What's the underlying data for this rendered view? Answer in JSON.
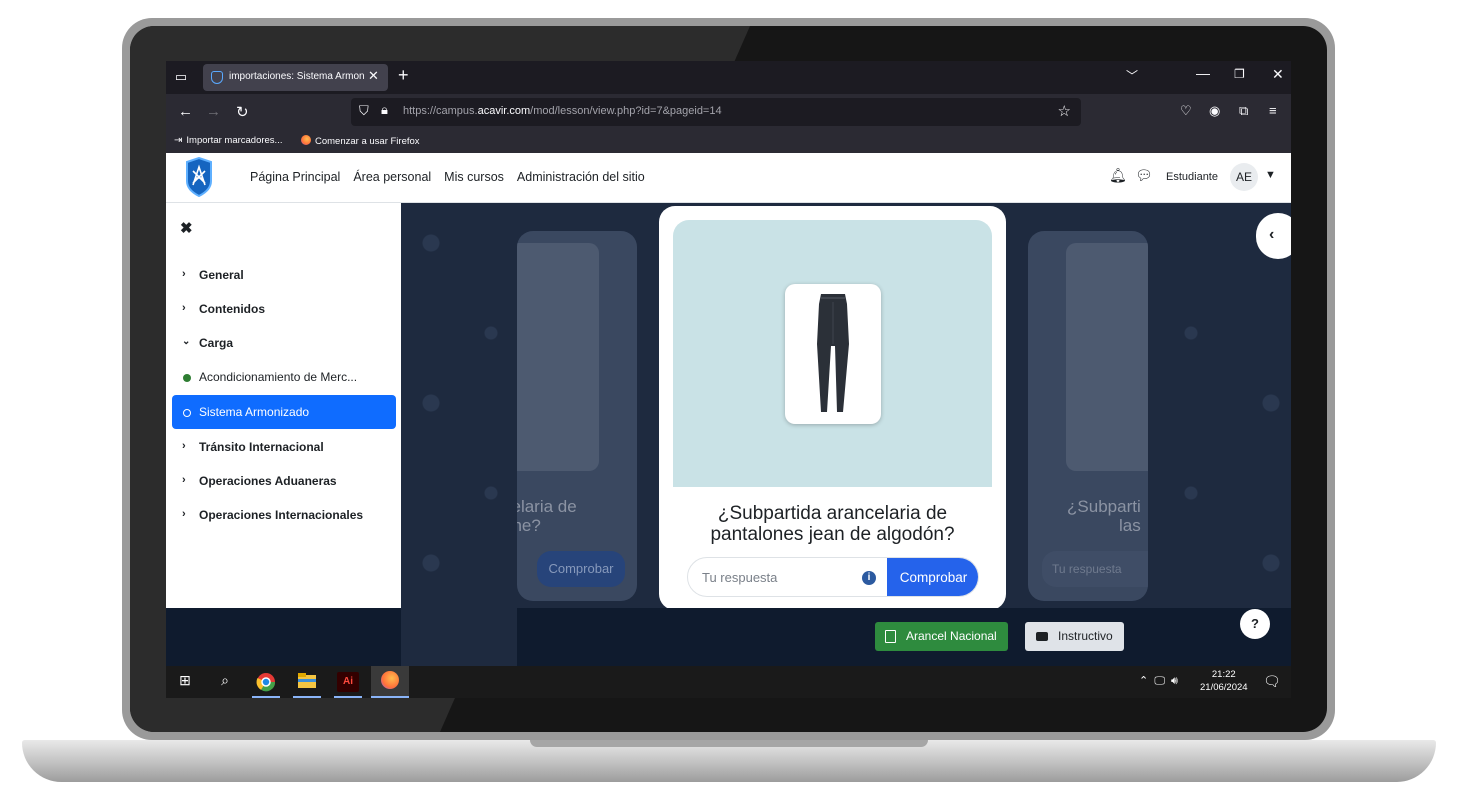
{
  "browser": {
    "tab_title": "importaciones: Sistema Armonizado",
    "tab_close": "✕",
    "new_tab": "+",
    "url_prefix": "https://campus.",
    "url_host": "acavir.com",
    "url_suffix": "/mod/lesson/view.php?id=7&pageid=14",
    "bookmarks": [
      "Importar marcadores...",
      "Comenzar a usar Firefox"
    ]
  },
  "header": {
    "nav": [
      "Página Principal",
      "Área personal",
      "Mis cursos",
      "Administración del sitio"
    ],
    "role": "Estudiante",
    "avatar": "AE"
  },
  "course_index": {
    "close": "✖",
    "items": [
      {
        "label": "General",
        "type": "section",
        "state": "collapsed"
      },
      {
        "label": "Contenidos",
        "type": "section",
        "state": "collapsed"
      },
      {
        "label": "Carga",
        "type": "section",
        "state": "expanded"
      },
      {
        "label": "Acondicionamiento de Merc...",
        "type": "activity",
        "status": "complete"
      },
      {
        "label": "Sistema Armonizado",
        "type": "activity",
        "status": "current"
      },
      {
        "label": "Tránsito Internacional",
        "type": "section",
        "state": "collapsed"
      },
      {
        "label": "Operaciones Aduaneras",
        "type": "section",
        "state": "collapsed"
      },
      {
        "label": "Operaciones Internacionales",
        "type": "section",
        "state": "collapsed"
      }
    ]
  },
  "lesson": {
    "question_line1": "¿Subpartida arancelaria de",
    "question_line2": "pantalones jean de algodón?",
    "answer_placeholder": "Tu respuesta",
    "info": "i",
    "check_label": "Comprobar",
    "left_card": {
      "line1": "celaria de",
      "line2": "one?",
      "button": "Comprobar"
    },
    "right_card": {
      "line1": "¿Subparti",
      "line2": "las",
      "placeholder": "Tu respuesta"
    }
  },
  "footer": {
    "arancel_label": "Arancel Nacional",
    "instructivo_label": "Instructivo",
    "help": "?"
  },
  "taskbar": {
    "time": "21:22",
    "date": "21/06/2024"
  },
  "colors": {
    "accent": "#0f6cff",
    "check_button": "#2563eb",
    "arancel_button": "#2e8b3e",
    "complete_dot": "#2e7d32"
  }
}
